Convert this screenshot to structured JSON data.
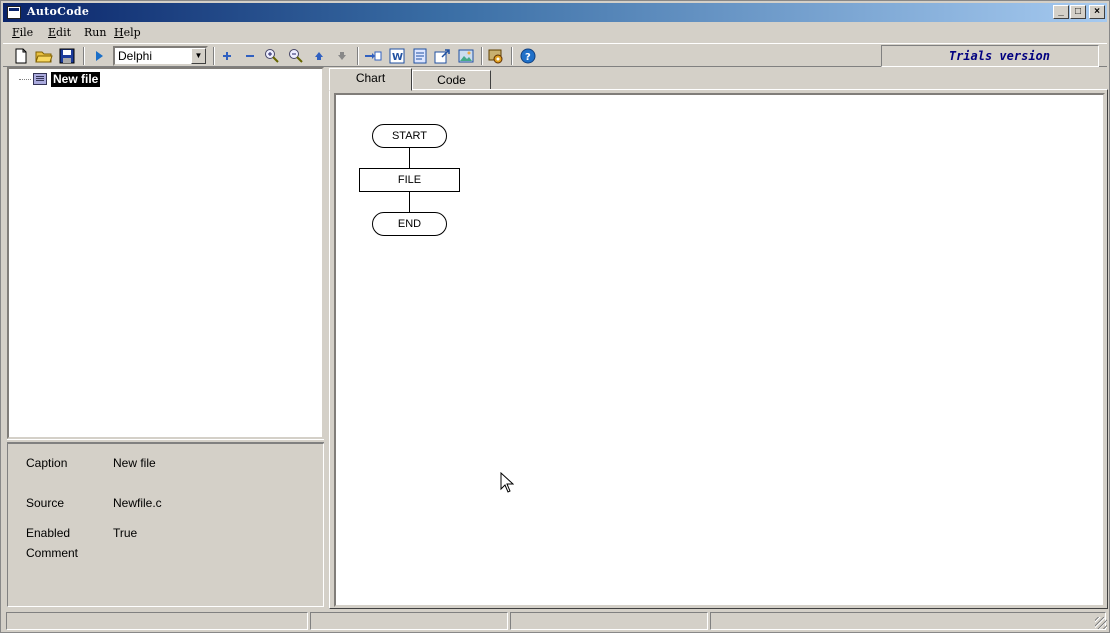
{
  "window": {
    "title": "AutoCode"
  },
  "menu": {
    "file": {
      "accel": "F",
      "rest": "ile"
    },
    "edit": {
      "accel": "E",
      "rest": "dit"
    },
    "run": {
      "label": "Run"
    },
    "help": {
      "accel": "H",
      "rest": "elp"
    }
  },
  "toolbar": {
    "language": "Delphi",
    "trials": "Trials version"
  },
  "tree": {
    "root_label": "New file"
  },
  "properties": [
    {
      "label": "Caption",
      "value": "New file"
    },
    {
      "label": "Source",
      "value": "Newfile.c"
    },
    {
      "label": "Enabled",
      "value": "True"
    },
    {
      "label": "Comment",
      "value": ""
    }
  ],
  "tabs": {
    "chart": "Chart",
    "code": "Code",
    "active": "Chart"
  },
  "flowchart": {
    "start": "START",
    "process": "FILE",
    "end": "END"
  }
}
